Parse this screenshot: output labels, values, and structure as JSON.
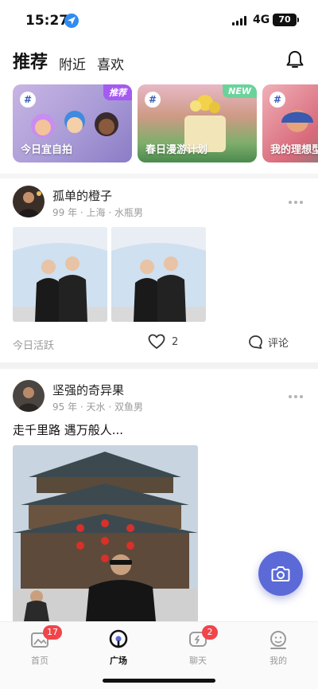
{
  "status_bar": {
    "time": "15:27",
    "network": "4G",
    "battery": "70"
  },
  "top_tabs": [
    {
      "label": "推荐",
      "active": true
    },
    {
      "label": "附近",
      "active": false
    },
    {
      "label": "喜欢",
      "active": false
    }
  ],
  "topics": [
    {
      "label": "今日宜自拍",
      "badge": "推荐",
      "badge_color": "#a45bf0"
    },
    {
      "label": "春日漫游计划",
      "badge": "NEW",
      "badge_color": "#6ad39a"
    },
    {
      "label": "我的理想型",
      "badge": "",
      "badge_color": ""
    }
  ],
  "posts": [
    {
      "user": "孤单的橙子",
      "meta": "99 年 · 上海 · 水瓶男",
      "active_label": "今日活跃",
      "likes": "2",
      "comment_label": "评论"
    },
    {
      "user": "坚强的奇异果",
      "meta": "95 年 · 天水 · 双鱼男",
      "text": "走千里路 遇万般人..."
    }
  ],
  "bottom_nav": [
    {
      "label": "首页",
      "badge": "17",
      "icon": "home-photo-icon"
    },
    {
      "label": "广场",
      "badge": "",
      "icon": "plaza-icon",
      "active": true
    },
    {
      "label": "聊天",
      "badge": "2",
      "icon": "chat-icon"
    },
    {
      "label": "我的",
      "badge": "",
      "icon": "profile-icon"
    }
  ],
  "colors": {
    "accent": "#5b6ad6",
    "badge_red": "#f0454a"
  }
}
